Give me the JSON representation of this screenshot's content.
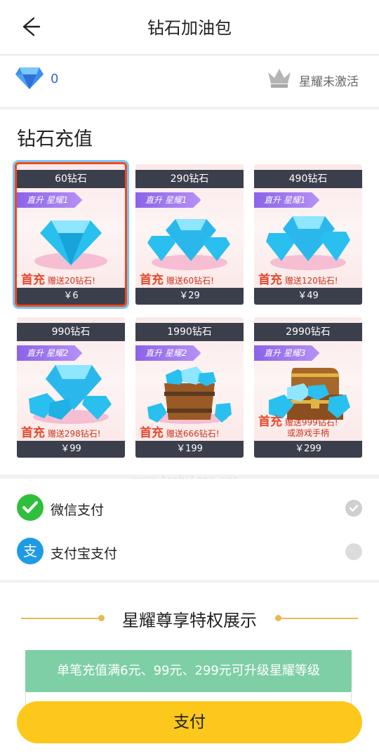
{
  "header": {
    "title": "钻石加油包",
    "back_icon": "back-arrow-icon"
  },
  "balance": {
    "diamond_count": "0",
    "star_status": "星耀未激活"
  },
  "recharge": {
    "title": "钻石充值",
    "cards": [
      {
        "amount": "60钻石",
        "badge": "直升 星耀1",
        "first": "首充",
        "bonus": "赠送20钻石!",
        "extra": "",
        "price": "￥6",
        "selected": true
      },
      {
        "amount": "290钻石",
        "badge": "直升 星耀1",
        "first": "首充",
        "bonus": "赠送60钻石!",
        "extra": "",
        "price": "￥29",
        "selected": false
      },
      {
        "amount": "490钻石",
        "badge": "直升 星耀1",
        "first": "首充",
        "bonus": "赠送120钻石!",
        "extra": "",
        "price": "￥49",
        "selected": false
      },
      {
        "amount": "990钻石",
        "badge": "直升 星耀2",
        "first": "首充",
        "bonus": "赠送298钻石!",
        "extra": "",
        "price": "￥99",
        "selected": false
      },
      {
        "amount": "1990钻石",
        "badge": "直升 星耀2",
        "first": "首充",
        "bonus": "赠送666钻石!",
        "extra": "",
        "price": "￥199",
        "selected": false
      },
      {
        "amount": "2990钻石",
        "badge": "直升 星耀3",
        "first": "首充",
        "bonus": "赠送999钻石!",
        "extra": "或游戏手柄",
        "price": "￥299",
        "selected": false
      }
    ]
  },
  "watermark": "www.ArabiApps.net",
  "payment_methods": [
    {
      "label": "微信支付",
      "icon": "wechat-icon",
      "selected": true
    },
    {
      "label": "支付宝支付",
      "icon": "alipay-icon",
      "selected": false
    }
  ],
  "privilege": {
    "title": "星耀尊享特权展示",
    "banner": "单笔充值满6元、99元、299元可升级星耀等级"
  },
  "pay_button": "支付",
  "colors": {
    "accent": "#fcc81c",
    "card_dark": "#3b3f4c",
    "badge_purple": "#8b63e8",
    "banner_green": "#7fcfa6",
    "selected_border": "#f2491d"
  }
}
